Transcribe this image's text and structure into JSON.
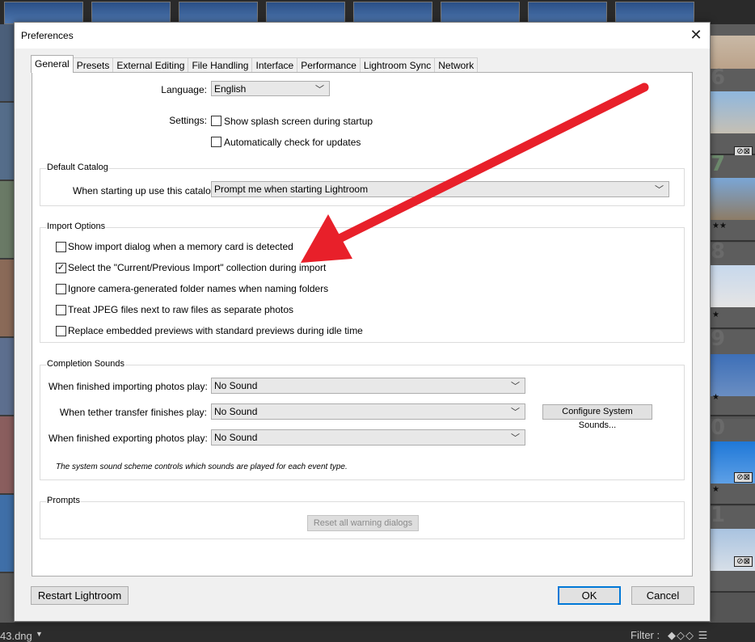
{
  "background": {
    "filename": "43.dng",
    "filter_label": "Filter :",
    "right_numbers": [
      "6",
      "7",
      "8",
      "9",
      "0",
      "1"
    ]
  },
  "dialog": {
    "title": "Preferences",
    "tabs": [
      "General",
      "Presets",
      "External Editing",
      "File Handling",
      "Interface",
      "Performance",
      "Lightroom Sync",
      "Network"
    ],
    "active_tab": "General",
    "language": {
      "label": "Language:",
      "value": "English"
    },
    "settings": {
      "label": "Settings:",
      "splash": {
        "label": "Show splash screen during startup",
        "checked": false
      },
      "updates": {
        "label": "Automatically check for updates",
        "checked": false
      }
    },
    "default_catalog": {
      "title": "Default Catalog",
      "label": "When starting up use this catalog:",
      "value": "Prompt me when starting Lightroom"
    },
    "import_options": {
      "title": "Import Options",
      "items": [
        {
          "label": "Show import dialog when a memory card is detected",
          "checked": false
        },
        {
          "label": "Select the \"Current/Previous Import\" collection during import",
          "checked": true
        },
        {
          "label": "Ignore camera-generated folder names when naming folders",
          "checked": false
        },
        {
          "label": "Treat JPEG files next to raw files as separate photos",
          "checked": false
        },
        {
          "label": "Replace embedded previews with standard previews during idle time",
          "checked": false
        }
      ]
    },
    "completion_sounds": {
      "title": "Completion Sounds",
      "importing": {
        "label": "When finished importing photos play:",
        "value": "No Sound"
      },
      "tether": {
        "label": "When tether transfer finishes play:",
        "value": "No Sound"
      },
      "exporting": {
        "label": "When finished exporting photos play:",
        "value": "No Sound"
      },
      "configure_button": "Configure System Sounds...",
      "note": "The system sound scheme controls which sounds are played for each event type."
    },
    "prompts": {
      "title": "Prompts",
      "reset_button": "Reset all warning dialogs"
    },
    "restart_button": "Restart Lightroom",
    "ok_button": "OK",
    "cancel_button": "Cancel"
  },
  "annotation": {
    "arrow_color": "#e8202a"
  }
}
